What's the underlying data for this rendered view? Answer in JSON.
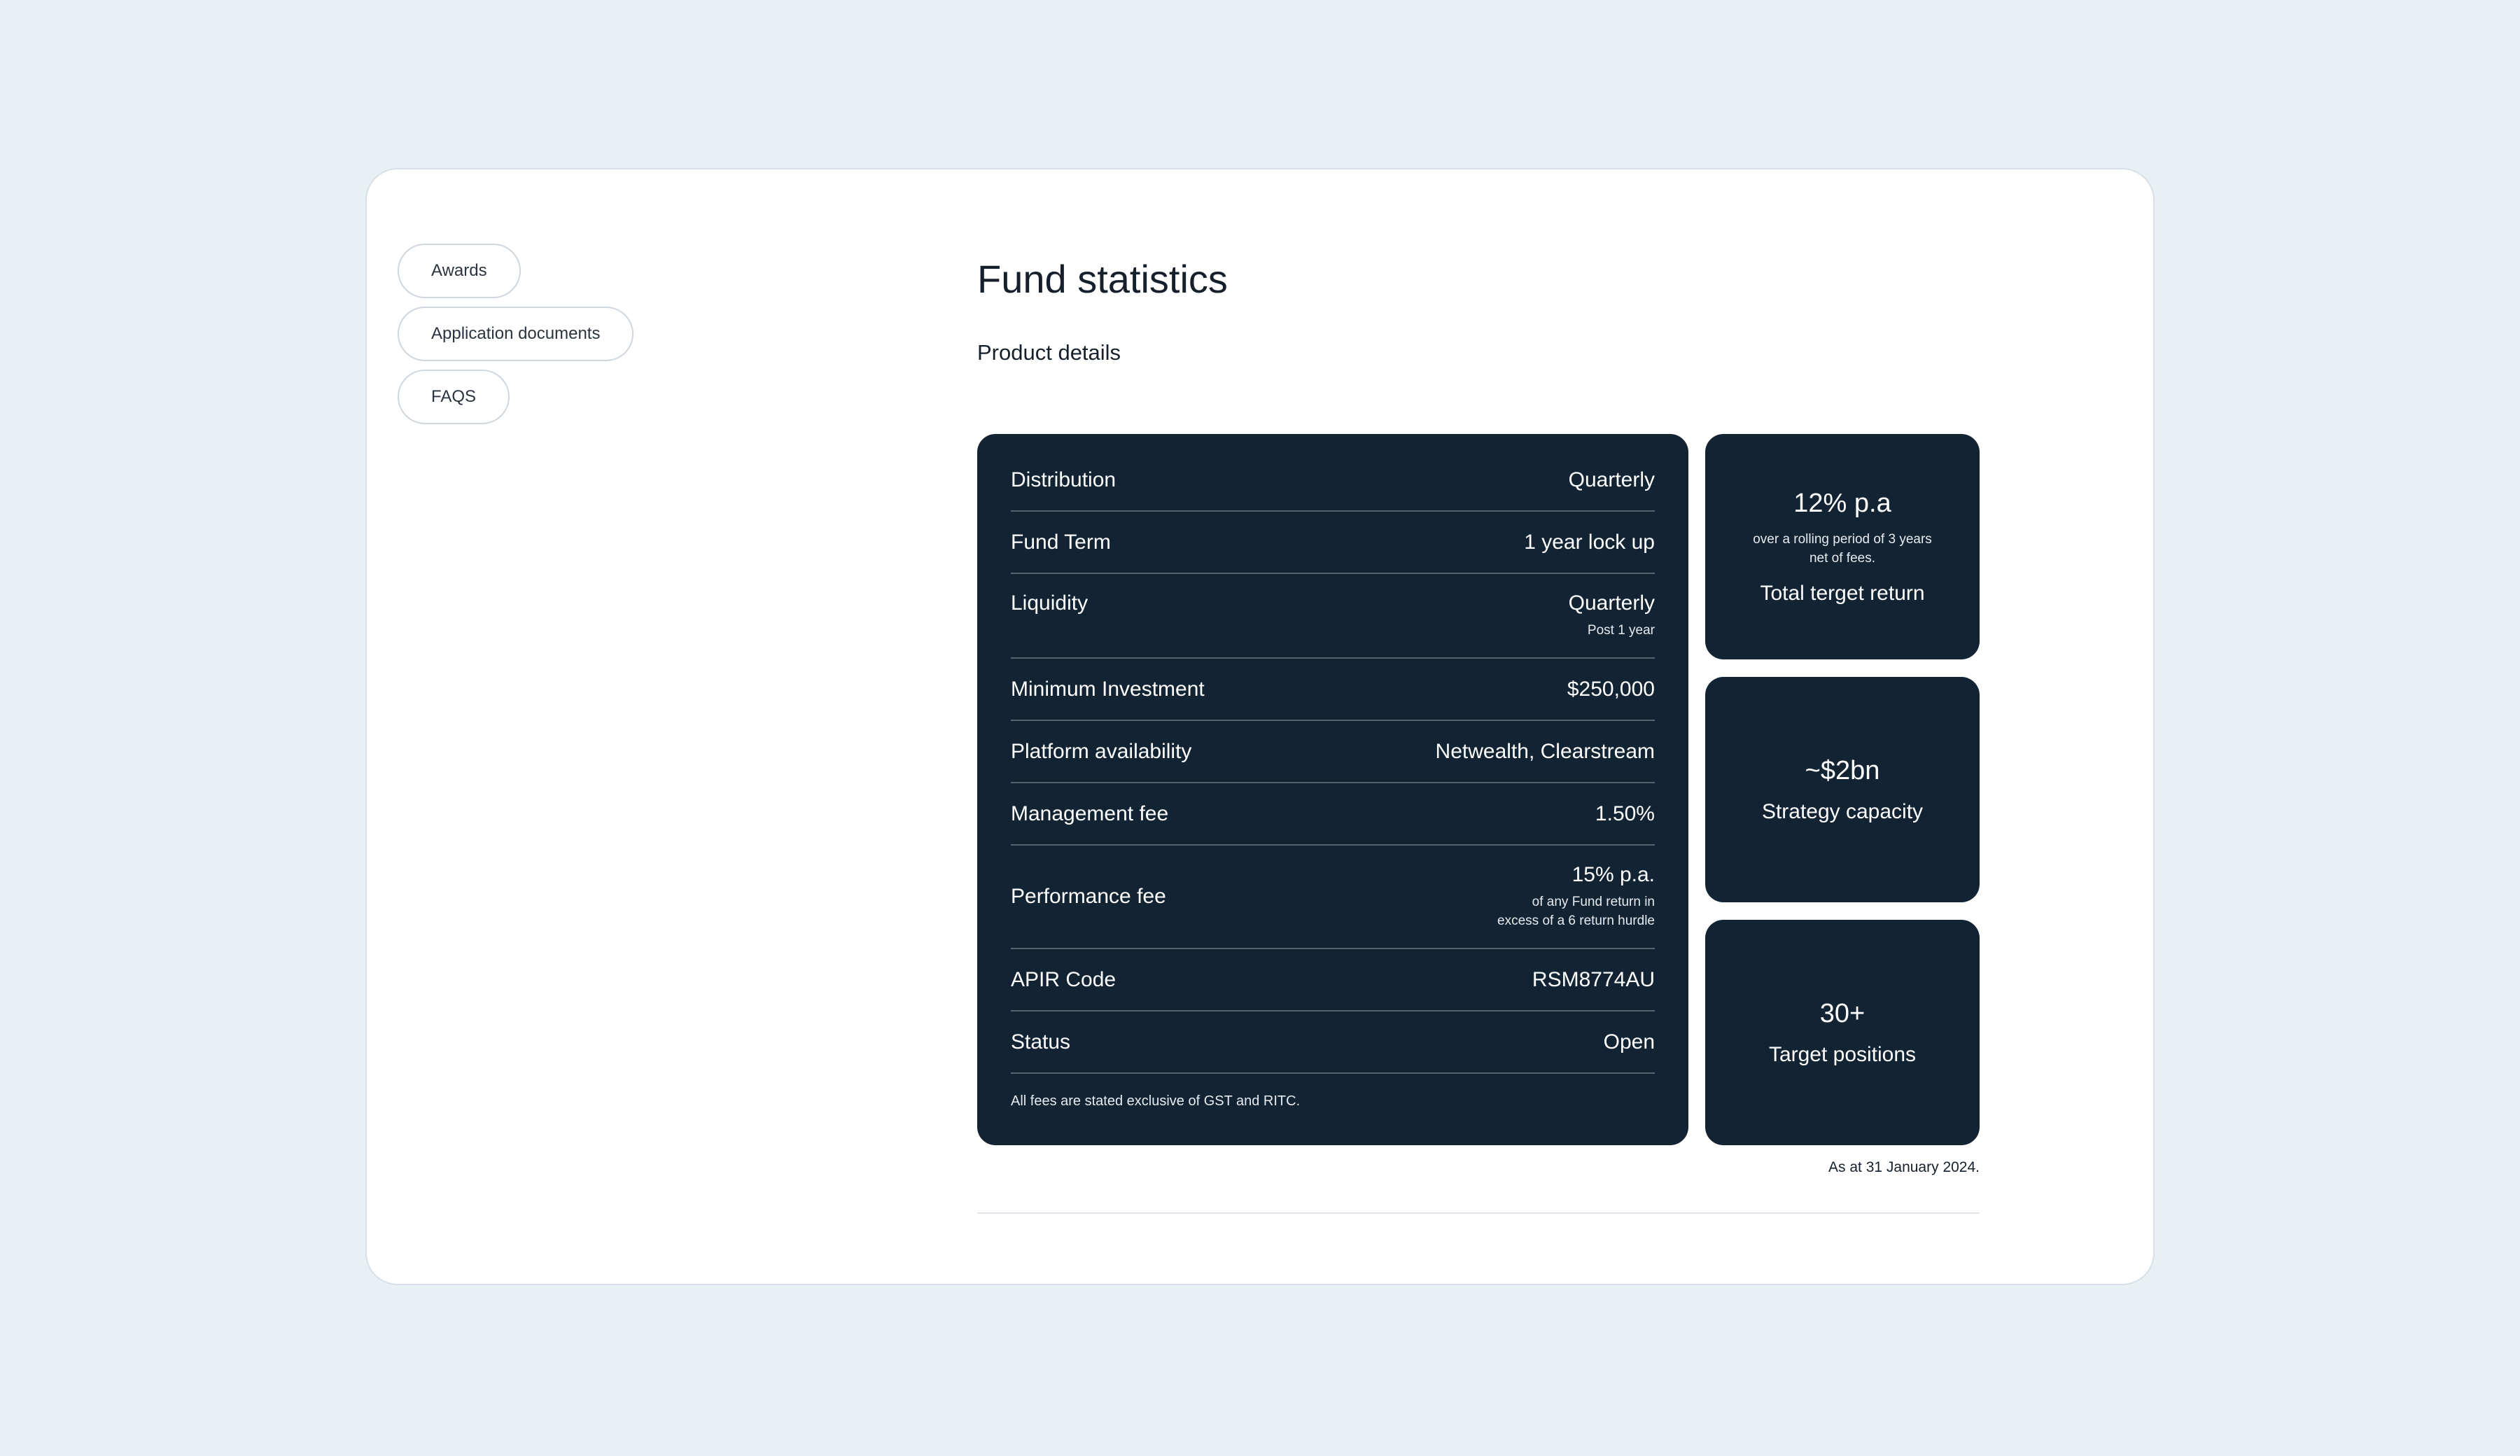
{
  "side_nav": {
    "items": [
      {
        "label": "Awards"
      },
      {
        "label": "Application documents"
      },
      {
        "label": "FAQS"
      }
    ]
  },
  "section": {
    "title": "Fund statistics",
    "subtitle": "Product details"
  },
  "details": {
    "rows": [
      {
        "label": "Distribution",
        "value": "Quarterly"
      },
      {
        "label": "Fund Term",
        "value": "1 year lock up"
      },
      {
        "label": "Liquidity",
        "value": "Quarterly",
        "note": "Post 1 year"
      },
      {
        "label": "Minimum Investment",
        "value": "$250,000"
      },
      {
        "label": "Platform availability",
        "value": "Netwealth, Clearstream"
      },
      {
        "label": "Management fee",
        "value": "1.50%"
      },
      {
        "label": "Performance fee",
        "value": "15% p.a.",
        "note": "of any Fund return in\nexcess of a 6 return hurdle"
      },
      {
        "label": "APIR Code",
        "value": "RSM8774AU"
      },
      {
        "label": "Status",
        "value": "Open"
      }
    ],
    "footnote": "All fees are stated exclusive of GST and RITC."
  },
  "stats": [
    {
      "value": "12% p.a",
      "note": "over a rolling period of 3 years net of fees.",
      "label": "Total terget return"
    },
    {
      "value": "~$2bn",
      "label": "Strategy capacity"
    },
    {
      "value": "30+",
      "label": "Target positions"
    }
  ],
  "as_at": "As at 31 January 2024.",
  "colors": {
    "page_background": "#e9f0f4",
    "panel_background": "#122334",
    "card_background": "#ffffff"
  }
}
